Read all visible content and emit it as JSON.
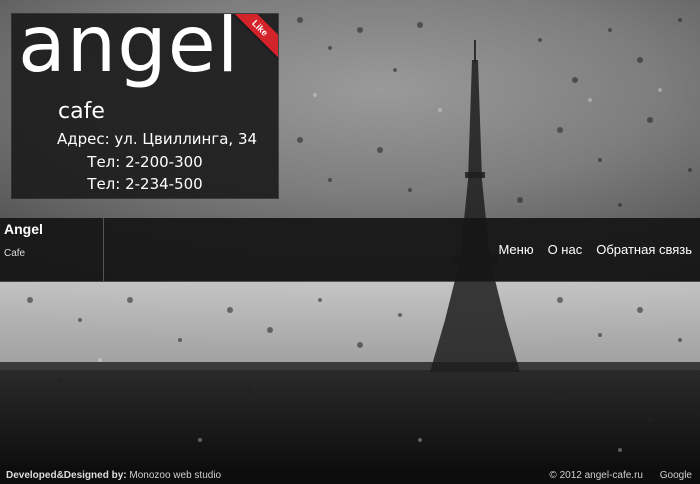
{
  "logo": {
    "word": "angel",
    "sub": "cafe",
    "address": "Адрес: ул. Цвиллинга, 34",
    "phone1": "Тел: 2-200-300",
    "phone2": "Тел: 2-234-500",
    "like_label": "Like",
    "ribbon_color": "#d4242b"
  },
  "navbar": {
    "brand_title": "Angel",
    "brand_sub": "Cafe",
    "links": [
      "Меню",
      "О нас",
      "Обратная связь"
    ]
  },
  "footer": {
    "dev_label": "Developed&Designed by:",
    "dev_name": "Monozoo web studio",
    "copyright": "© 2012 angel-cafe.ru",
    "google": "Google"
  }
}
